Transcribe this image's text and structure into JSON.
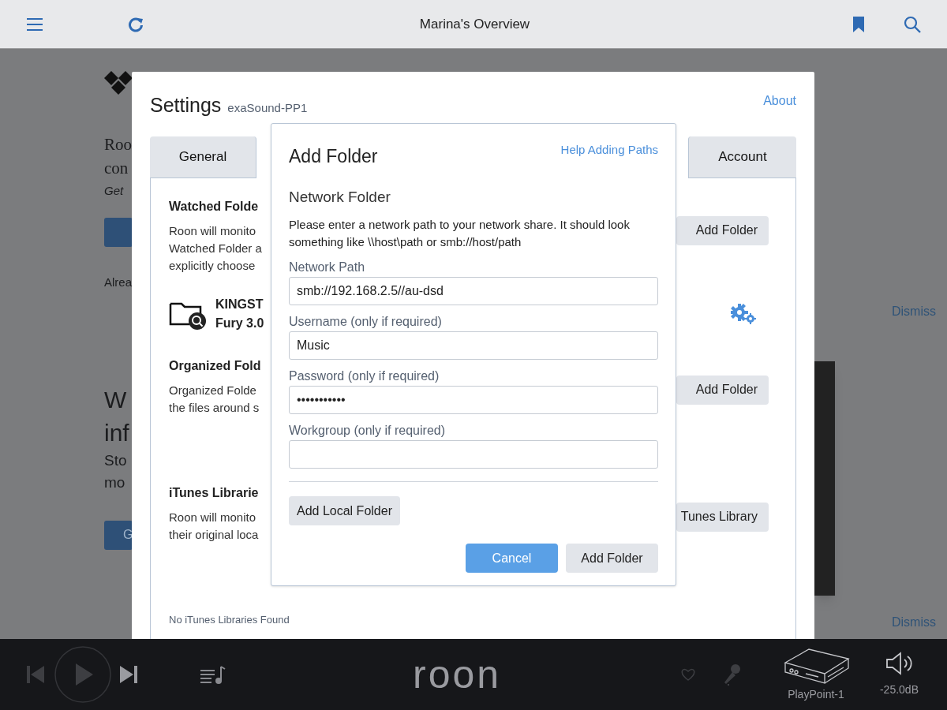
{
  "top_bar": {
    "title": "Marina's Overview"
  },
  "background": {
    "lines": [
      {
        "kind": "serif",
        "text": "Roo"
      },
      {
        "kind": "serif",
        "text": "con"
      },
      {
        "kind": "italic",
        "text": "Get"
      },
      {
        "kind": "button"
      },
      {
        "kind": "plain",
        "text": "Alrea"
      }
    ],
    "lines2": [
      {
        "kind": "large",
        "text": "W"
      },
      {
        "kind": "large",
        "text": "inf"
      },
      {
        "kind": "medium",
        "text": "Sto"
      },
      {
        "kind": "medium",
        "text": "mo"
      },
      {
        "kind": "button",
        "text": "G"
      }
    ],
    "dismiss": [
      "Dismiss",
      "Dismiss"
    ]
  },
  "settings": {
    "title": "Settings",
    "device": "exaSound-PP1",
    "about": "About",
    "tabs": [
      {
        "label": "General",
        "selected": false
      },
      {
        "label": "Account",
        "selected": false
      }
    ],
    "sections": [
      {
        "heading": "Watched Folde",
        "lines": [
          "Roon will monito",
          "Watched Folder a",
          "explicitly choose"
        ],
        "button": "Add Folder",
        "folder": {
          "name": [
            "KINGST",
            "Fury 3.0"
          ]
        }
      },
      {
        "heading": "Organized Fold",
        "lines": [
          "Organized Folde",
          "the files around s"
        ],
        "button": "Add Folder"
      },
      {
        "heading": "iTunes Librarie",
        "lines": [
          "Roon will monito",
          "their original loca"
        ],
        "button": "Tunes Library",
        "note": "No iTunes Libraries Found"
      }
    ]
  },
  "add_folder": {
    "title": "Add Folder",
    "help": "Help Adding Paths",
    "subtitle": "Network Folder",
    "description": "Please enter a network path to your network share. It should look something like \\\\host\\path or smb://host/path",
    "fields": [
      {
        "label": "Network Path",
        "value": "smb://192.168.2.5//au-dsd"
      },
      {
        "label": "Username (only if required)",
        "value": "Music"
      },
      {
        "label": "Password (only if required)",
        "value": "•••••••••••"
      },
      {
        "label": "Workgroup (only if required)"
      }
    ],
    "local_button": "Add Local Folder",
    "buttons": [
      {
        "label": "Cancel",
        "kind": "primary"
      },
      {
        "label": "Add Folder",
        "kind": "secondary"
      }
    ]
  },
  "player": {
    "logo": "roon",
    "zone": "PlayPoint-1",
    "volume": "-25.0dB"
  }
}
